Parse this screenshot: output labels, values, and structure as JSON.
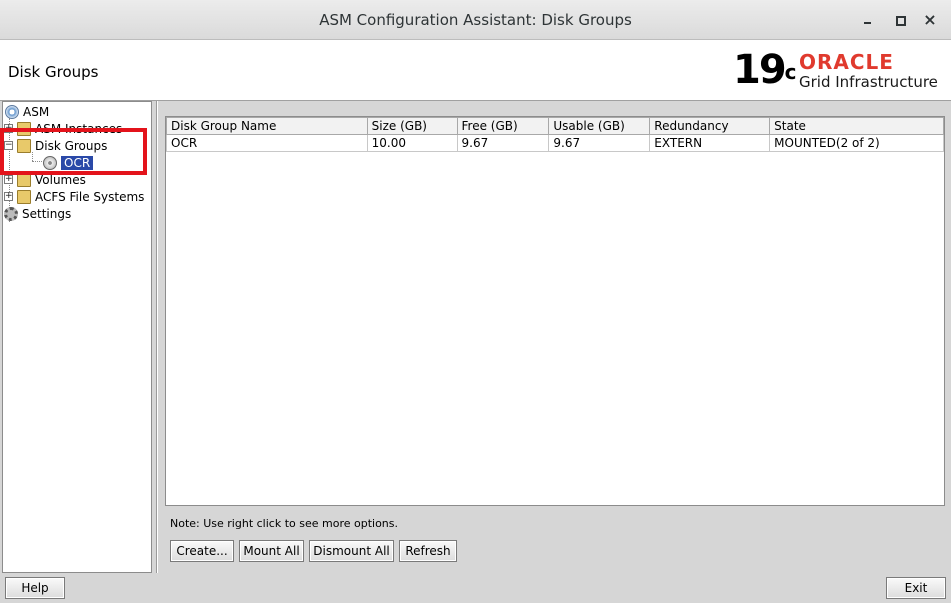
{
  "window": {
    "title": "ASM Configuration Assistant: Disk Groups"
  },
  "header": {
    "page_title": "Disk Groups",
    "logo": {
      "version": "19",
      "superscript": "c",
      "brand": "ORACLE",
      "product": "Grid Infrastructure"
    }
  },
  "tree": {
    "root": "ASM",
    "items": [
      {
        "label": "ASM Instances",
        "expander": "+"
      },
      {
        "label": "Disk Groups",
        "expander": "−"
      },
      {
        "label": "OCR",
        "selected": true
      },
      {
        "label": "Volumes",
        "expander": "+"
      },
      {
        "label": "ACFS File Systems",
        "expander": "+"
      },
      {
        "label": "Settings"
      }
    ]
  },
  "table": {
    "columns": [
      "Disk Group Name",
      "Size (GB)",
      "Free (GB)",
      "Usable (GB)",
      "Redundancy",
      "State"
    ],
    "rows": [
      [
        "OCR",
        "10.00",
        "9.67",
        "9.67",
        "EXTERN",
        "MOUNTED(2 of 2)"
      ]
    ]
  },
  "note": "Note: Use right click to see more options.",
  "buttons": {
    "create": "Create...",
    "mount_all": "Mount All",
    "dismount_all": "Dismount All",
    "refresh": "Refresh",
    "help": "Help",
    "exit": "Exit"
  },
  "colors": {
    "selection": "#2a49a8",
    "highlight_box": "#e3131b",
    "oracle_red": "#e03a2e"
  }
}
